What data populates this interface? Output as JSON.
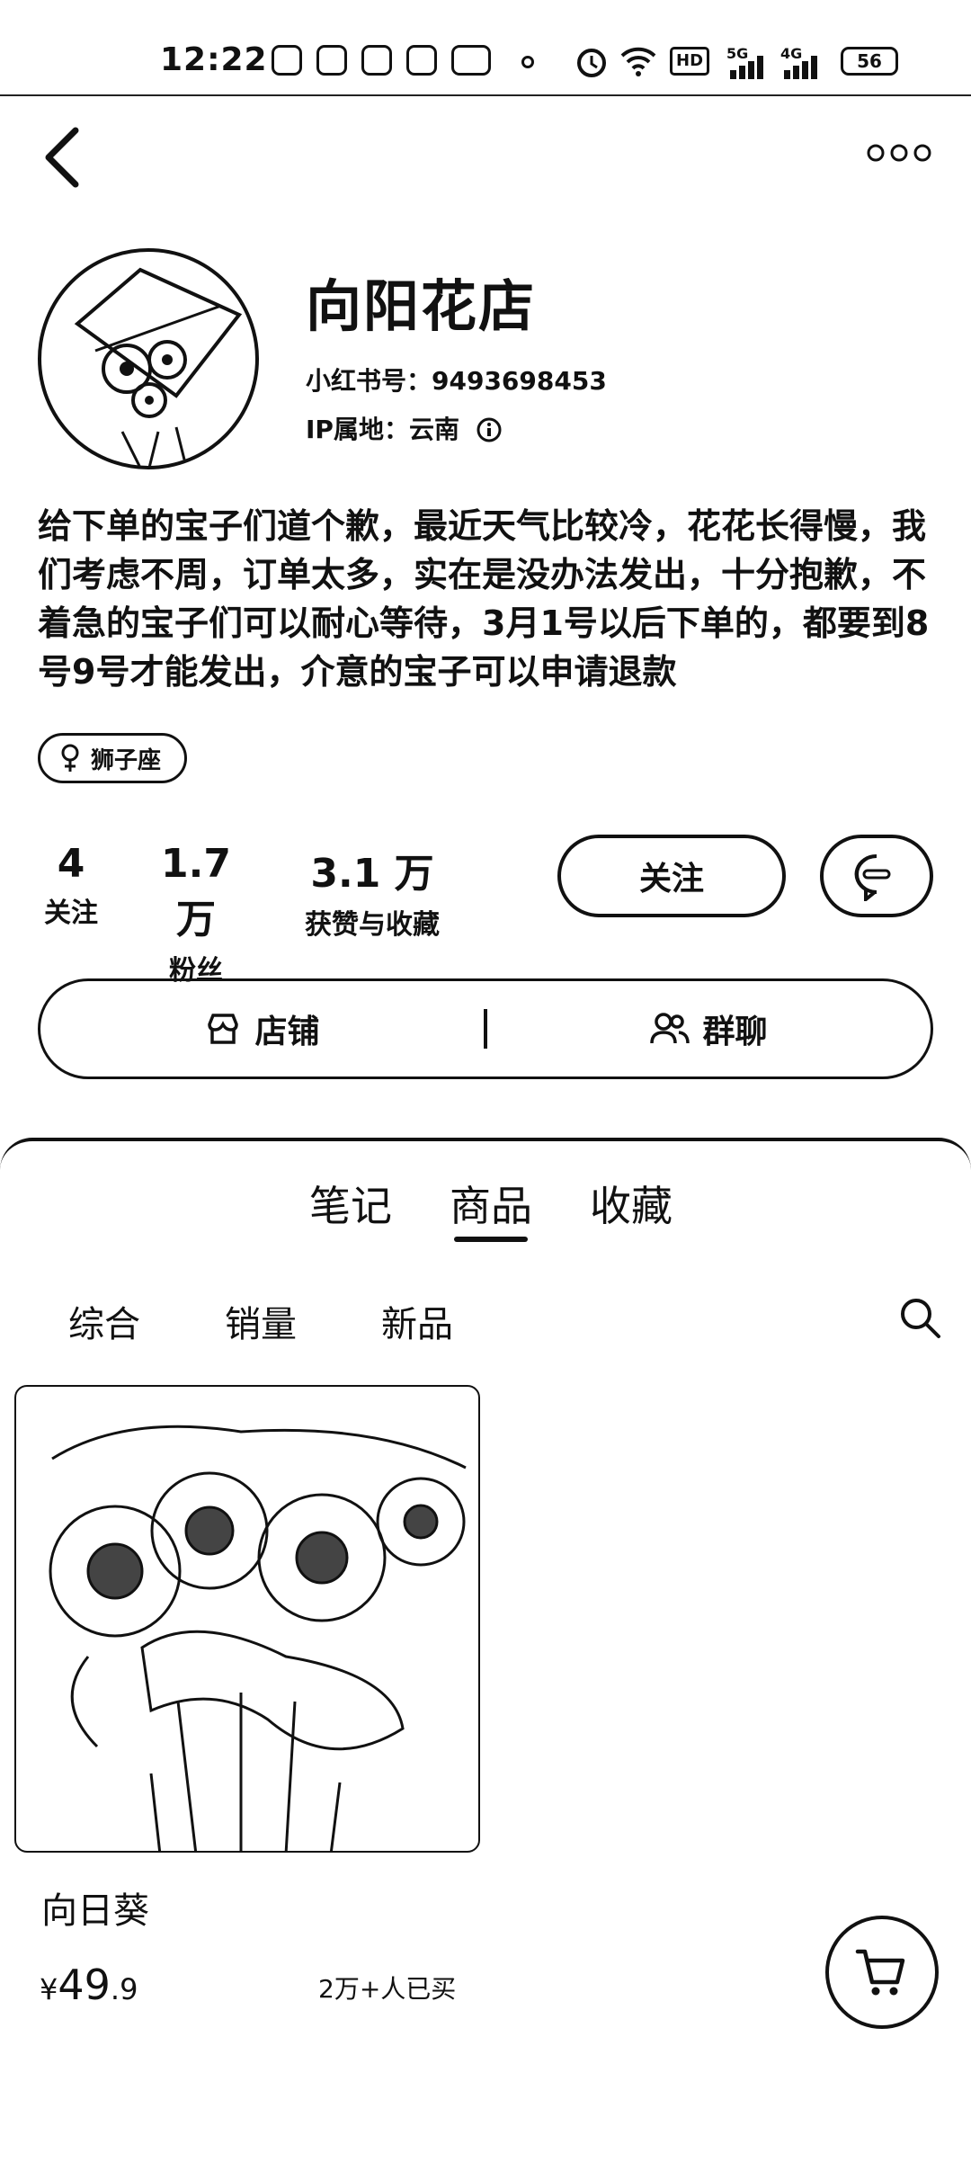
{
  "status_bar": {
    "time": "12:22",
    "hd_label": "HD",
    "net_5g": "5G",
    "net_4g": "4G",
    "battery": "56"
  },
  "profile": {
    "name": "向阳花店",
    "red_id": "小红书号：9493698453",
    "ip_location": "IP属地：云南",
    "bio": "给下单的宝子们道个歉，最近天气比较冷，花花长得慢，我们考虑不周，订单太多，实在是没办法发出，十分抱歉，不着急的宝子们可以耐心等待，3月1号以后下单的，都要到8号9号才能发出，介意的宝子可以申请退款",
    "tag": "狮子座"
  },
  "stats": {
    "following_count": "4",
    "following_label": "关注",
    "fans_count": "1.7 万",
    "fans_label": "粉丝",
    "likes_count": "3.1 万",
    "likes_label": "获赞与收藏"
  },
  "actions": {
    "follow_label": "关注",
    "shop_label": "店铺",
    "group_chat_label": "群聊"
  },
  "tabs": {
    "items": [
      "笔记",
      "商品",
      "收藏"
    ],
    "active": "商品"
  },
  "sort": {
    "items": [
      "综合",
      "销量",
      "新品"
    ]
  },
  "products": [
    {
      "title": "向日葵",
      "price_symbol": "¥",
      "price_int": "49",
      "price_dec": ".9",
      "sold": "2万+人已买"
    }
  ]
}
